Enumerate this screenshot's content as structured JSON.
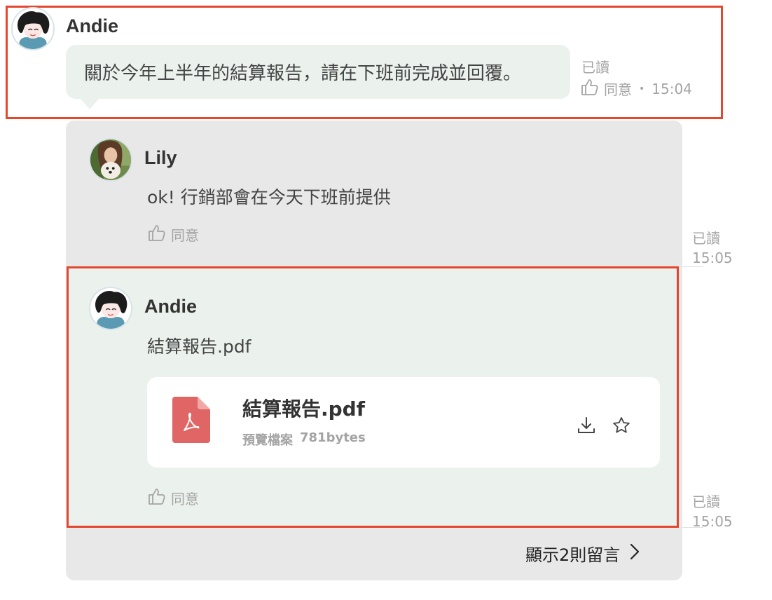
{
  "message": {
    "author": "Andie",
    "text": "關於今年上半年的結算報告，請在下班前完成並回覆。",
    "read_status": "已讀",
    "agree_label": "同意",
    "separator": "•",
    "time": "15:04"
  },
  "replies": [
    {
      "author": "Lily",
      "text": "ok! 行銷部會在今天下班前提供",
      "agree_label": "同意",
      "read_status": "已讀",
      "time": "15:05"
    },
    {
      "author": "Andie",
      "text": "結算報告.pdf",
      "agree_label": "同意",
      "read_status": "已讀",
      "time": "15:05",
      "attachment": {
        "file_name": "結算報告.pdf",
        "preview_label": "預覽檔案",
        "size": "781bytes"
      }
    }
  ],
  "show_more_label": "顯示2則留言",
  "icons": {
    "like": "thumbs-up-icon",
    "download": "download-icon",
    "star": "star-icon",
    "pdf": "pdf-file-icon",
    "chevron": "chevron-right-icon"
  },
  "colors": {
    "highlight": "#e4472e",
    "bubble": "#ebf2ee",
    "thread_bg": "#e8e8e8",
    "pdf_red": "#e06666",
    "muted_text": "#a4a4a4"
  }
}
